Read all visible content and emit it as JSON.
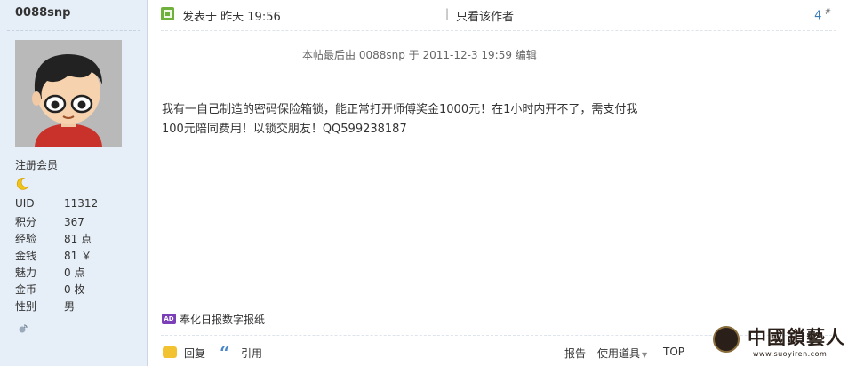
{
  "author": {
    "username": "0088snp",
    "group": "注册会员",
    "stats": [
      {
        "label": "UID",
        "value": "11312"
      },
      {
        "label": "积分",
        "value": "367"
      },
      {
        "label": "经验",
        "value": "81 点"
      },
      {
        "label": "金钱",
        "value": "81 ￥"
      },
      {
        "label": "魅力",
        "value": "0 点"
      },
      {
        "label": "金币",
        "value": "0 枚"
      },
      {
        "label": "性别",
        "value": "男"
      }
    ]
  },
  "post": {
    "posted_prefix": "发表于",
    "posted_time": "昨天 19:56",
    "separator": "|",
    "only_author": "只看该作者",
    "floor_number": "4",
    "floor_mark": "#",
    "edit_note": "本帖最后由 0088snp 于 2011-12-3 19:59 编辑",
    "content_line1": "我有一自己制造的密码保险箱锁，能正常打开师傅奖金1000元！在1小时内开不了，需支付我",
    "content_line2": "100元陪同费用！以锁交朋友！QQ599238187",
    "ad_badge": "AD",
    "ad_text": "奉化日报数字报纸"
  },
  "footer": {
    "reply": "回复",
    "quote": "引用",
    "report": "报告",
    "tools": "使用道具",
    "top": "TOP"
  },
  "watermark": {
    "title": "中國鎖藝人",
    "url": "www.suoyiren.com"
  },
  "colors": {
    "sidebar_bg": "#e6eef7",
    "floor_link": "#3a7bb9",
    "post_icon": "#6fb13b",
    "reply_icon": "#f2c230",
    "quote_icon": "#4a86c8",
    "ad_badge": "#7b3fb8"
  },
  "icons": {
    "rank": "crescent-moon-icon",
    "post": "post-icon",
    "reply": "reply-icon",
    "quote": "quote-icon",
    "ad": "ad-icon",
    "mini": "satellite-icon"
  }
}
